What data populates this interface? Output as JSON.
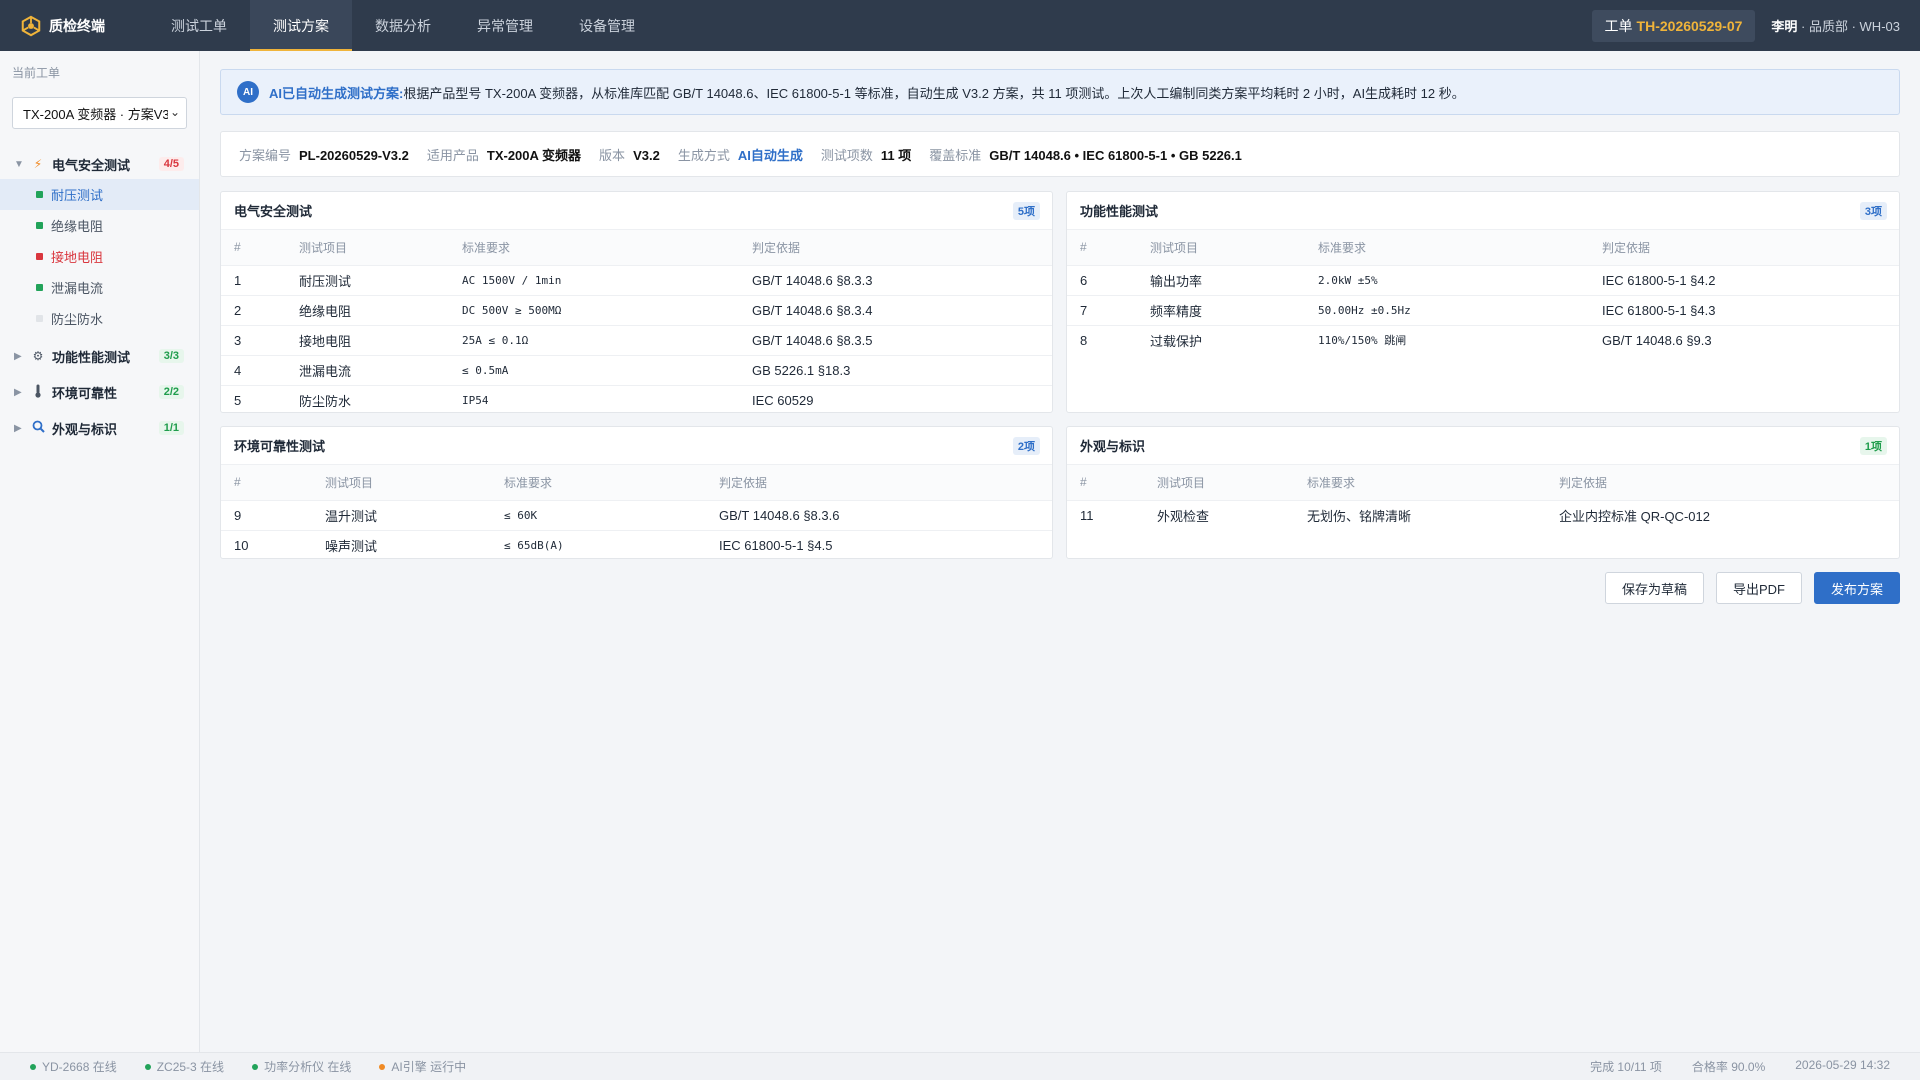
{
  "app": {
    "name": "质检终端"
  },
  "nav": {
    "tabs": [
      "测试工单",
      "测试方案",
      "数据分析",
      "异常管理",
      "设备管理"
    ],
    "active_index": 1
  },
  "header": {
    "order_label": "工单",
    "order_id": "TH-20260529-07",
    "user_name": "李明",
    "user_suffix": "· 品质部 · WH-03"
  },
  "sidebar": {
    "title": "当前工单",
    "select_value": "TX-200A 变频器 · 方案V3.2",
    "groups": [
      {
        "label": "电气安全测试",
        "icon": "lightning-icon",
        "count": "4/5",
        "expanded": true,
        "items": [
          {
            "label": "耐压测试",
            "status": "pass",
            "active": true
          },
          {
            "label": "绝缘电阻",
            "status": "pass"
          },
          {
            "label": "接地电阻",
            "status": "fail"
          },
          {
            "label": "泄漏电流",
            "status": "pass"
          },
          {
            "label": "防尘防水",
            "status": "pending"
          }
        ]
      },
      {
        "label": "功能性能测试",
        "icon": "gear-icon",
        "count": "3/3"
      },
      {
        "label": "环境可靠性",
        "icon": "thermometer-icon",
        "count": "2/2"
      },
      {
        "label": "外观与标识",
        "icon": "magnifier-icon",
        "count": "1/1"
      }
    ]
  },
  "banner": {
    "badge": "AI",
    "title": "AI已自动生成测试方案:",
    "text": "根据产品型号 TX-200A 变频器，从标准库匹配 GB/T 14048.6、IEC 61800-5-1 等标准，自动生成 V3.2 方案，共 11 项测试。上次人工编制同类方案平均耗时 2 小时，AI生成耗时 12 秒。"
  },
  "meta": [
    {
      "key": "方案编号",
      "value": "PL-20260529-V3.2"
    },
    {
      "key": "适用产品",
      "value": "TX-200A 变频器"
    },
    {
      "key": "版本",
      "value": "V3.2"
    },
    {
      "key": "生成方式",
      "value": "AI自动生成"
    },
    {
      "key": "测试项数",
      "value": "11 项"
    },
    {
      "key": "覆盖标准",
      "value": "GB/T 14048.6 • IEC 61800-5-1 • GB 5226.1"
    }
  ],
  "table_headers": [
    "#",
    "测试项目",
    "标准要求",
    "判定依据"
  ],
  "sections": [
    {
      "title": "电气安全测试",
      "count": "5项",
      "rows": [
        [
          "1",
          "耐压测试",
          "AC 1500V / 1min",
          "GB/T 14048.6 §8.3.3"
        ],
        [
          "2",
          "绝缘电阻",
          "DC 500V ≥ 500MΩ",
          "GB/T 14048.6 §8.3.4"
        ],
        [
          "3",
          "接地电阻",
          "25A ≤ 0.1Ω",
          "GB/T 14048.6 §8.3.5"
        ],
        [
          "4",
          "泄漏电流",
          "≤ 0.5mA",
          "GB 5226.1 §18.3"
        ],
        [
          "5",
          "防尘防水",
          "IP54",
          "IEC 60529"
        ]
      ]
    },
    {
      "title": "功能性能测试",
      "count": "3项",
      "rows": [
        [
          "6",
          "输出功率",
          "2.0kW ±5%",
          "IEC 61800-5-1 §4.2"
        ],
        [
          "7",
          "频率精度",
          "50.00Hz ±0.5Hz",
          "IEC 61800-5-1 §4.3"
        ],
        [
          "8",
          "过载保护",
          "110%/150% 跳闸",
          "GB/T 14048.6 §9.3"
        ]
      ]
    },
    {
      "title": "环境可靠性测试",
      "count": "2项",
      "rows": [
        [
          "9",
          "温升测试",
          "≤ 60K",
          "GB/T 14048.6 §8.3.6"
        ],
        [
          "10",
          "噪声测试",
          "≤ 65dB(A)",
          "IEC 61800-5-1 §4.5"
        ]
      ]
    },
    {
      "title": "外观与标识",
      "count": "1项",
      "rows": [
        [
          "11",
          "外观检查",
          "无划伤、铭牌清晰",
          "企业内控标准 QR-QC-012"
        ]
      ]
    }
  ],
  "actions": {
    "save_draft": "保存为草稿",
    "export_pdf": "导出PDF",
    "publish": "发布方案"
  },
  "status": {
    "devices": [
      {
        "label": "YD-2668 在线",
        "color": "#22a35a"
      },
      {
        "label": "ZC25-3 在线",
        "color": "#22a35a"
      },
      {
        "label": "功率分析仪 在线",
        "color": "#22a35a"
      },
      {
        "label": "AI引擎 运行中",
        "color": "#f08a24"
      }
    ],
    "progress": "完成 10/11 项",
    "pass_rate": "合格率 90.0%",
    "datetime": "2026-05-29 14:32"
  },
  "colors": {
    "topbar": "#2f3b4c",
    "accent": "#f0b43a",
    "primary": "#2f6fc8",
    "pass": "#22a35a",
    "fail": "#d9363e"
  }
}
